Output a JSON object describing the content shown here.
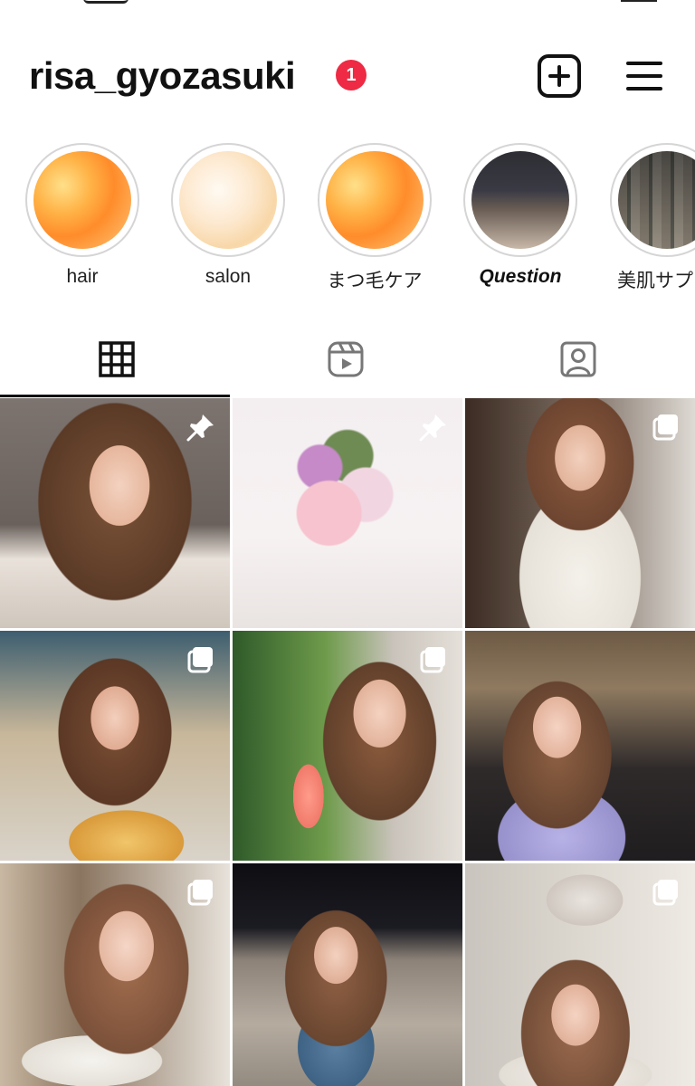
{
  "profile": {
    "username": "risa_gyozasuki",
    "notification_count": "1",
    "notification_color": "#ee2a44"
  },
  "header_actions": {
    "new_post_icon": "plus-square-icon",
    "menu_icon": "hamburger-menu-icon"
  },
  "highlights": [
    {
      "label": "hair",
      "thumbnail": "orange-watercolor"
    },
    {
      "label": "salon",
      "thumbnail": "cream-watercolor"
    },
    {
      "label": "まつ毛ケア",
      "thumbnail": "orange-watercolor"
    },
    {
      "label": "Question",
      "thumbnail": "photo"
    },
    {
      "label": "美肌サプ",
      "thumbnail": "photo"
    }
  ],
  "tabs": [
    {
      "name": "posts",
      "icon": "grid-icon",
      "active": true
    },
    {
      "name": "reels",
      "icon": "reels-icon",
      "active": false
    },
    {
      "name": "tagged",
      "icon": "tagged-person-icon",
      "active": false
    }
  ],
  "posts": [
    {
      "badge": "pin-icon"
    },
    {
      "badge": "pin-icon"
    },
    {
      "badge": "carousel-icon"
    },
    {
      "badge": "carousel-icon"
    },
    {
      "badge": "carousel-icon"
    },
    {
      "badge": "none"
    },
    {
      "badge": "carousel-icon"
    },
    {
      "badge": "none"
    },
    {
      "badge": "carousel-icon"
    }
  ]
}
